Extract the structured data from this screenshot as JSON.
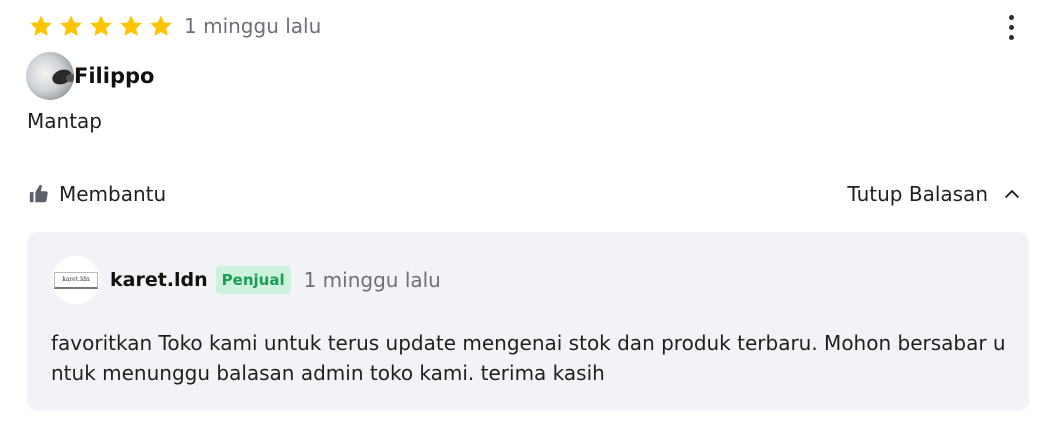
{
  "review": {
    "rating": 5,
    "max_rating": 5,
    "time": "1 minggu lalu",
    "user_name": "Filippo",
    "text": "Mantap",
    "helpful_label": "Membantu",
    "toggle_replies_label": "Tutup Balasan",
    "colors": {
      "star": "#ffc400",
      "badge_bg": "#cdf3dc",
      "badge_text": "#1a9d55",
      "reply_bg": "#f2f3f6"
    }
  },
  "reply": {
    "seller_name": "karet.ldn",
    "seller_logo_text": "karet.ldn",
    "badge": "Penjual",
    "time": "1 minggu lalu",
    "text": "favoritkan Toko kami untuk terus update mengenai stok dan produk terbaru. Mohon bersabar untuk menunggu balasan admin toko kami. terima kasih"
  },
  "icons": {
    "star": "star-icon",
    "more": "more-vertical-icon",
    "thumbs_up": "thumbs-up-icon",
    "chevron": "chevron-up-icon"
  }
}
